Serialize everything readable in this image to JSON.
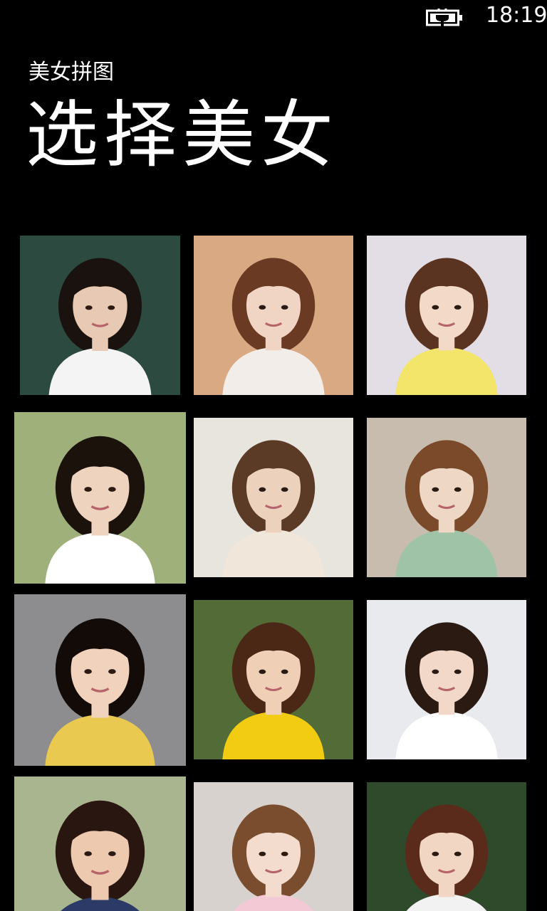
{
  "status_bar": {
    "time": "18:19",
    "battery_icon": "battery-charging-icon"
  },
  "header": {
    "app_title": "美女拼图",
    "page_title": "选择美女"
  },
  "photos": [
    {
      "name": "photo-1",
      "bg": "#2c4a3f",
      "accent": "#f4f4f4",
      "hair": "#1a120e",
      "skin": "#e8c9b3"
    },
    {
      "name": "photo-2",
      "bg": "#d9a983",
      "accent": "#f2ede8",
      "hair": "#6b3a22",
      "skin": "#f1d5c4"
    },
    {
      "name": "photo-3",
      "bg": "#e3dde6",
      "accent": "#f3e56a",
      "hair": "#5a3420",
      "skin": "#f3d9c8"
    },
    {
      "name": "photo-4",
      "bg": "#9fb07a",
      "accent": "#ffffff",
      "hair": "#1b120c",
      "skin": "#eed3bf"
    },
    {
      "name": "photo-5",
      "bg": "#e8e4de",
      "accent": "#f0e6da",
      "hair": "#5b3a26",
      "skin": "#ecd2bd"
    },
    {
      "name": "photo-6",
      "bg": "#c7bcae",
      "accent": "#9fc3a6",
      "hair": "#7a4a2b",
      "skin": "#efd7c6"
    },
    {
      "name": "photo-7",
      "bg": "#8d8d8f",
      "accent": "#e9c94f",
      "hair": "#120b08",
      "skin": "#f0d2bd"
    },
    {
      "name": "photo-8",
      "bg": "#536b37",
      "accent": "#f1cc12",
      "hair": "#4b2715",
      "skin": "#f0cfb7"
    },
    {
      "name": "photo-9",
      "bg": "#e8eaee",
      "accent": "#ffffff",
      "hair": "#2a1a12",
      "skin": "#f1d8c8"
    },
    {
      "name": "photo-10",
      "bg": "#a9b58f",
      "accent": "#2b3a66",
      "hair": "#2a1610",
      "skin": "#edc9b0"
    },
    {
      "name": "photo-11",
      "bg": "#d8d2cf",
      "accent": "#f4c9d6",
      "hair": "#7a4d2e",
      "skin": "#f3dccd"
    },
    {
      "name": "photo-12",
      "bg": "#2f4a2a",
      "accent": "#f2f2f2",
      "hair": "#5a2b1a",
      "skin": "#f1d6c3"
    }
  ]
}
